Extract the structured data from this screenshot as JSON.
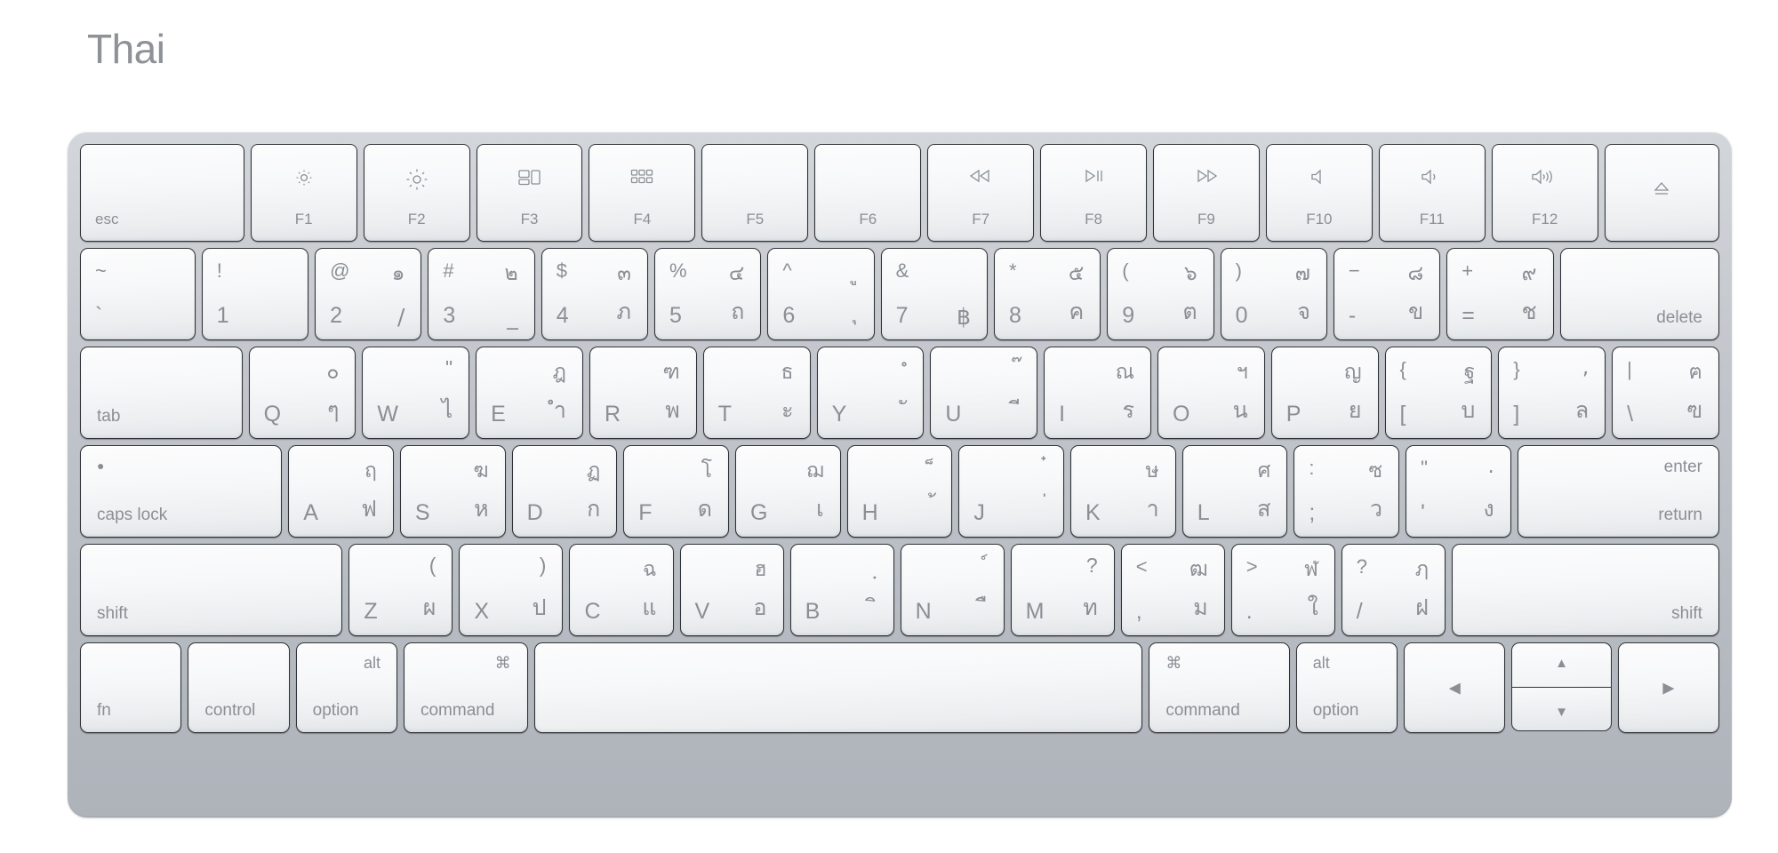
{
  "page": {
    "title": "Thai",
    "layout_name": "Thai",
    "device": "Apple Magic Keyboard"
  },
  "colors": {
    "title_gray": "#8e9196",
    "key_face": "#f7f8f9",
    "key_border": "#2f3337",
    "chassis": "#c2c6cc",
    "legend_gray": "#8b8f94",
    "background": "#ffffff"
  },
  "function_row": [
    {
      "name": "esc",
      "label": "esc",
      "icon": "",
      "align": "left",
      "width": 1.55
    },
    {
      "name": "f1",
      "label": "F1",
      "icon": "brightness-down-icon",
      "align": "center",
      "width": 1
    },
    {
      "name": "f2",
      "label": "F2",
      "icon": "brightness-up-icon",
      "align": "center",
      "width": 1
    },
    {
      "name": "f3",
      "label": "F3",
      "icon": "mission-control-icon",
      "align": "center",
      "width": 1
    },
    {
      "name": "f4",
      "label": "F4",
      "icon": "launchpad-icon",
      "align": "center",
      "width": 1
    },
    {
      "name": "f5",
      "label": "F5",
      "icon": "",
      "align": "center",
      "width": 1
    },
    {
      "name": "f6",
      "label": "F6",
      "icon": "",
      "align": "center",
      "width": 1
    },
    {
      "name": "f7",
      "label": "F7",
      "icon": "rewind-icon",
      "align": "center",
      "width": 1
    },
    {
      "name": "f8",
      "label": "F8",
      "icon": "play-pause-icon",
      "align": "center",
      "width": 1
    },
    {
      "name": "f9",
      "label": "F9",
      "icon": "fast-forward-icon",
      "align": "center",
      "width": 1
    },
    {
      "name": "f10",
      "label": "F10",
      "icon": "mute-icon",
      "align": "center",
      "width": 1
    },
    {
      "name": "f11",
      "label": "F11",
      "icon": "volume-down-icon",
      "align": "center",
      "width": 1
    },
    {
      "name": "f12",
      "label": "F12",
      "icon": "volume-up-icon",
      "align": "center",
      "width": 1
    },
    {
      "name": "eject",
      "label": "",
      "icon": "eject-icon",
      "align": "center",
      "width": 1.08
    }
  ],
  "number_row": [
    {
      "name": "backquote",
      "shift": "~",
      "base": "`",
      "thai_shift": "",
      "thai_base": "",
      "width": 1.08
    },
    {
      "name": "digit1",
      "shift": "!",
      "base": "1",
      "thai_shift": "",
      "thai_base": "",
      "width": 1
    },
    {
      "name": "digit2",
      "shift": "@",
      "base": "2",
      "thai_shift": "๑",
      "thai_base": "/",
      "width": 1
    },
    {
      "name": "digit3",
      "shift": "#",
      "base": "3",
      "thai_shift": "๒",
      "thai_base": "_",
      "width": 1
    },
    {
      "name": "digit4",
      "shift": "$",
      "base": "4",
      "thai_shift": "๓",
      "thai_base": "ภ",
      "width": 1
    },
    {
      "name": "digit5",
      "shift": "%",
      "base": "5",
      "thai_shift": "๔",
      "thai_base": "ถ",
      "width": 1
    },
    {
      "name": "digit6",
      "shift": "^",
      "base": "6",
      "thai_shift": "ู",
      "thai_base": "ุ",
      "width": 1
    },
    {
      "name": "digit7",
      "shift": "&",
      "base": "7",
      "thai_shift": "฿",
      "thai_base": "฿",
      "width": 1
    },
    {
      "name": "digit8",
      "shift": "*",
      "base": "8",
      "thai_shift": "๕",
      "thai_base": "ค",
      "width": 1
    },
    {
      "name": "digit9",
      "shift": "(",
      "base": "9",
      "thai_shift": "๖",
      "thai_base": "ต",
      "width": 1
    },
    {
      "name": "digit0",
      "shift": ")",
      "base": "0",
      "thai_shift": "๗",
      "thai_base": "จ",
      "width": 1
    },
    {
      "name": "minus",
      "shift": "−",
      "base": "-",
      "thai_shift": "๘",
      "thai_base": "ข",
      "width": 1
    },
    {
      "name": "equal",
      "shift": "+",
      "base": "=",
      "thai_shift": "๙",
      "thai_base": "ช",
      "width": 1
    },
    {
      "name": "delete",
      "shift": "",
      "base": "delete",
      "thai_shift": "",
      "thai_base": "",
      "width": 1.5
    }
  ],
  "q_row": [
    {
      "name": "tab",
      "shift": "",
      "base": "tab",
      "thai_shift": "",
      "thai_base": "",
      "width": 1.52
    },
    {
      "name": "keyq",
      "shift": "",
      "base": "Q",
      "thai_shift": "๐",
      "thai_base": "ๆ",
      "width": 1
    },
    {
      "name": "keyw",
      "shift": "",
      "base": "W",
      "thai_shift": "\"",
      "thai_base": "ไ",
      "width": 1
    },
    {
      "name": "keye",
      "shift": "",
      "base": "E",
      "thai_shift": "ฎ",
      "thai_base": "ำ",
      "width": 1
    },
    {
      "name": "keyr",
      "shift": "",
      "base": "R",
      "thai_shift": "ฑ",
      "thai_base": "พ",
      "width": 1
    },
    {
      "name": "keyt",
      "shift": "",
      "base": "T",
      "thai_shift": "ธ",
      "thai_base": "ะ",
      "width": 1
    },
    {
      "name": "keyy",
      "shift": "",
      "base": "Y",
      "thai_shift": "ํ",
      "thai_base": "ั",
      "width": 1
    },
    {
      "name": "keyu",
      "shift": "",
      "base": "U",
      "thai_shift": "๊",
      "thai_base": "ี",
      "width": 1
    },
    {
      "name": "keyi",
      "shift": "",
      "base": "I",
      "thai_shift": "ณ",
      "thai_base": "ร",
      "width": 1
    },
    {
      "name": "keyo",
      "shift": "",
      "base": "O",
      "thai_shift": "ฯ",
      "thai_base": "น",
      "width": 1
    },
    {
      "name": "keyp",
      "shift": "",
      "base": "P",
      "thai_shift": "ญ",
      "thai_base": "ย",
      "width": 1
    },
    {
      "name": "bracketleft",
      "shift": "{",
      "base": "[",
      "thai_shift": "ฐ",
      "thai_base": "บ",
      "width": 1
    },
    {
      "name": "bracketright",
      "shift": "}",
      "base": "]",
      "thai_shift": ",",
      "thai_base": "ล",
      "width": 1
    },
    {
      "name": "backslash",
      "shift": "|",
      "base": "\\",
      "thai_shift": "ฅ",
      "thai_base": "ฃ",
      "width": 1
    }
  ],
  "a_row": [
    {
      "name": "capslock",
      "shift": "",
      "base": "caps lock",
      "thai_shift": "",
      "thai_base": "",
      "width": 1.93
    },
    {
      "name": "keya",
      "shift": "",
      "base": "A",
      "thai_shift": "ฤ",
      "thai_base": "ฟ",
      "width": 1
    },
    {
      "name": "keys",
      "shift": "",
      "base": "S",
      "thai_shift": "ฆ",
      "thai_base": "ห",
      "width": 1
    },
    {
      "name": "keyd",
      "shift": "",
      "base": "D",
      "thai_shift": "ฏ",
      "thai_base": "ก",
      "width": 1
    },
    {
      "name": "keyf",
      "shift": "",
      "base": "F",
      "thai_shift": "โ",
      "thai_base": "ด",
      "width": 1
    },
    {
      "name": "keyg",
      "shift": "",
      "base": "G",
      "thai_shift": "ฌ",
      "thai_base": "เ",
      "width": 1
    },
    {
      "name": "keyh",
      "shift": "",
      "base": "H",
      "thai_shift": "็",
      "thai_base": "้",
      "width": 1
    },
    {
      "name": "keyj",
      "shift": "",
      "base": "J",
      "thai_shift": "๋",
      "thai_base": "่",
      "width": 1
    },
    {
      "name": "keyk",
      "shift": "",
      "base": "K",
      "thai_shift": "ษ",
      "thai_base": "า",
      "width": 1
    },
    {
      "name": "keyl",
      "shift": "",
      "base": "L",
      "thai_shift": "ศ",
      "thai_base": "ส",
      "width": 1
    },
    {
      "name": "semicolon",
      "shift": ":",
      "base": ";",
      "thai_shift": "ซ",
      "thai_base": "ว",
      "width": 1
    },
    {
      "name": "quote",
      "shift": "\"",
      "base": "'",
      "thai_shift": ".",
      "thai_base": "ง",
      "width": 1
    },
    {
      "name": "return",
      "shift": "enter",
      "base": "return",
      "thai_shift": "",
      "thai_base": "",
      "width": 1.93
    }
  ],
  "z_row": [
    {
      "name": "shift-left",
      "shift": "",
      "base": "shift",
      "thai_shift": "",
      "thai_base": "",
      "width": 2.55
    },
    {
      "name": "keyz",
      "shift": "(",
      "base": "Z",
      "thai_shift": "",
      "thai_base": "ผ",
      "width": 1
    },
    {
      "name": "keyx",
      "shift": ")",
      "base": "X",
      "thai_shift": "",
      "thai_base": "ป",
      "width": 1
    },
    {
      "name": "keyc",
      "shift": "",
      "base": "C",
      "thai_shift": "ฉ",
      "thai_base": "แ",
      "width": 1
    },
    {
      "name": "keyv",
      "shift": "",
      "base": "V",
      "thai_shift": "ฮ",
      "thai_base": "อ",
      "width": 1
    },
    {
      "name": "keyb",
      "shift": "",
      "base": "B",
      "thai_shift": "ฺ",
      "thai_base": "ิ",
      "width": 1
    },
    {
      "name": "keyn",
      "shift": "",
      "base": "N",
      "thai_shift": "์",
      "thai_base": "ื",
      "width": 1
    },
    {
      "name": "keym",
      "shift": "?",
      "base": "M",
      "thai_shift": "",
      "thai_base": "ท",
      "width": 1
    },
    {
      "name": "comma",
      "shift": "<",
      "base": ",",
      "thai_shift": "ฒ",
      "thai_base": "ม",
      "width": 1
    },
    {
      "name": "period",
      "shift": ">",
      "base": ".",
      "thai_shift": "ฬ",
      "thai_base": "ใ",
      "width": 1
    },
    {
      "name": "slash",
      "shift": "?",
      "base": "/",
      "thai_shift": "ฦ",
      "thai_base": "ฝ",
      "width": 1
    },
    {
      "name": "shift-right",
      "shift": "",
      "base": "shift",
      "thai_shift": "",
      "thai_base": "",
      "width": 2.6
    }
  ],
  "modifier_row": [
    {
      "name": "fn",
      "top": "",
      "label": "fn",
      "icon": "",
      "align": "left",
      "width": 1.02
    },
    {
      "name": "control-left",
      "top": "",
      "label": "control",
      "icon": "",
      "align": "left",
      "width": 1.02
    },
    {
      "name": "option-left",
      "top": "alt",
      "label": "option",
      "icon": "",
      "align": "left",
      "width": 1.02
    },
    {
      "name": "command-left",
      "top": "",
      "label": "command",
      "icon": "command-icon",
      "align": "left",
      "width": 1.25
    },
    {
      "name": "space",
      "top": "",
      "label": "",
      "icon": "",
      "align": "center",
      "width": 6.2
    },
    {
      "name": "command-right",
      "top": "",
      "label": "command",
      "icon": "command-icon",
      "align": "left",
      "width": 1.42
    },
    {
      "name": "option-right",
      "top": "alt",
      "label": "option",
      "icon": "",
      "align": "left",
      "width": 1.02
    },
    {
      "name": "arrow-left",
      "top": "",
      "label": "",
      "icon": "arrow-left-icon",
      "align": "center",
      "width": 1.02
    },
    {
      "name": "arrow-updown",
      "top": "",
      "label": "",
      "icon": "arrow-up-down-icon",
      "align": "center",
      "width": 1.02
    },
    {
      "name": "arrow-right",
      "top": "",
      "label": "",
      "icon": "arrow-right-icon",
      "align": "center",
      "width": 1.02
    }
  ],
  "icons": {
    "brightness_down": "brightness-down-icon",
    "brightness_up": "brightness-up-icon",
    "mission_control": "mission-control-icon",
    "launchpad": "launchpad-icon",
    "rewind": "rewind-icon",
    "play_pause": "play-pause-icon",
    "fast_forward": "fast-forward-icon",
    "mute": "mute-icon",
    "volume_down": "volume-down-icon",
    "volume_up": "volume-up-icon",
    "eject": "eject-icon",
    "command": "command-icon",
    "arrow_up": "▲",
    "arrow_down": "▼",
    "arrow_left": "◀",
    "arrow_right": "▶"
  }
}
